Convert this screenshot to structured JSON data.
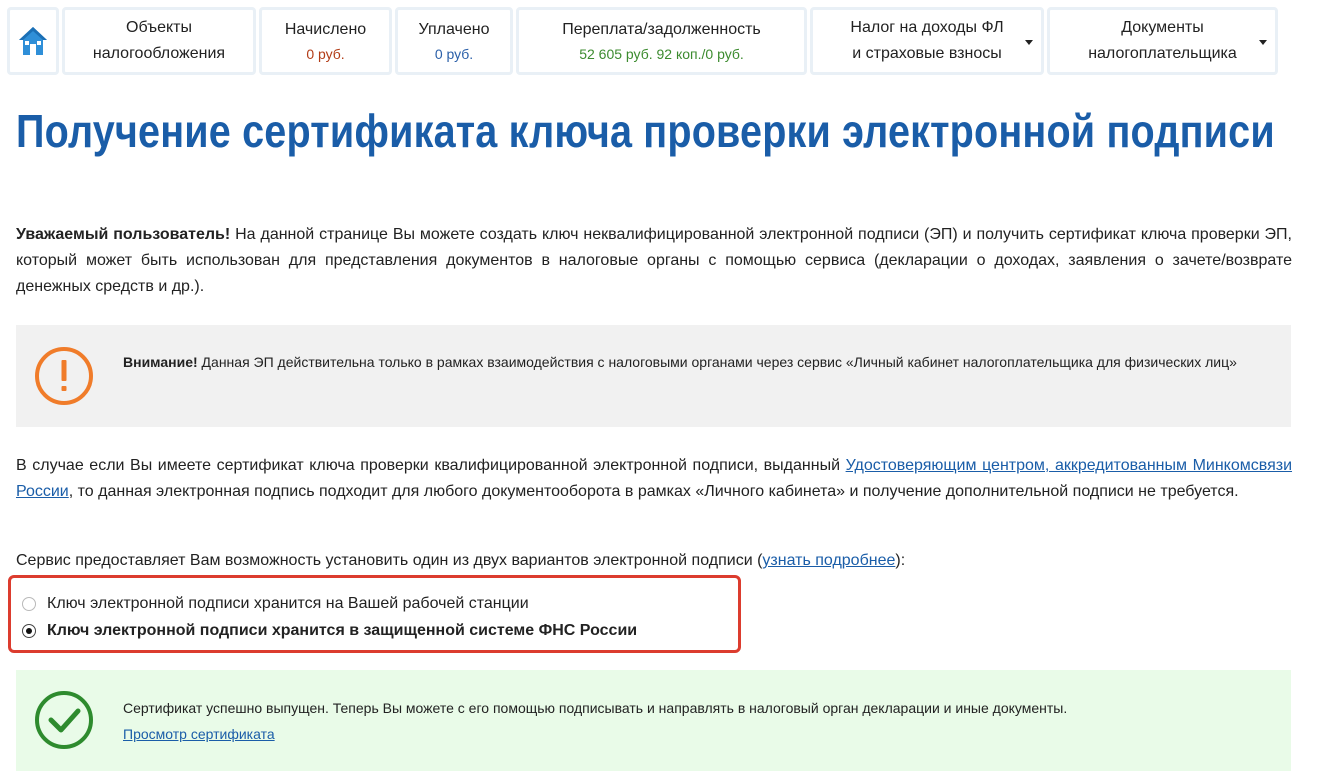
{
  "nav": {
    "tabs": [
      {
        "line1": "Объекты",
        "line2": "налогообложения"
      },
      {
        "title": "Начислено",
        "value": "0 руб."
      },
      {
        "title": "Уплачено",
        "value": "0 руб."
      },
      {
        "title": "Переплата/задолженность",
        "value": "52 605 руб. 92 коп./0 руб."
      },
      {
        "line1": "Налог на доходы ФЛ",
        "line2": "и страховые взносы"
      },
      {
        "line1": "Документы",
        "line2": "налогоплательщика"
      }
    ]
  },
  "page": {
    "title": "Получение сертификата ключа проверки электронной подписи",
    "intro_bold": "Уважаемый пользователь!",
    "intro_text": " На данной странице Вы можете создать ключ неквалифицированной электронной подписи (ЭП) и получить сертификат ключа проверки ЭП, который может быть использован для представления документов в налоговые органы с помощью сервиса (декларации о доходах, заявления о зачете/возврате денежных средств и др.).",
    "warning_bold": "Внимание!",
    "warning_text": " Данная ЭП действительна только в рамках взаимодействия с налоговыми органами через сервис «Личный кабинет налогоплательщика для физических лиц»",
    "qualified_text_1": "В случае если Вы имеете сертификат ключа проверки квалифицированной электронной подписи, выданный ",
    "qualified_link": "Удостоверяющим центром, аккредитованным Минкомсвязи России",
    "qualified_text_2": ", то данная электронная подпись подходит для любого документооборота в рамках «Личного кабинета» и получение дополнительной подписи не требуется.",
    "options_text_1": "Сервис предоставляет Вам возможность установить один из двух вариантов электронной подписи (",
    "options_link": "узнать подробнее",
    "options_text_2": "):",
    "radio_1": "Ключ электронной подписи хранится на Вашей рабочей станции",
    "radio_2": "Ключ электронной подписи хранится в защищенной системе ФНС России",
    "success_text": "Сертификат успешно выпущен. Теперь Вы можете с его помощью подписывать и направлять в налоговый орган декларации и иные документы.",
    "success_link": "Просмотр сертификата"
  },
  "colors": {
    "accent": "#1a5da8",
    "warning": "#f07c2a",
    "success": "#2e8b2e",
    "highlight": "#dc3c2e"
  }
}
